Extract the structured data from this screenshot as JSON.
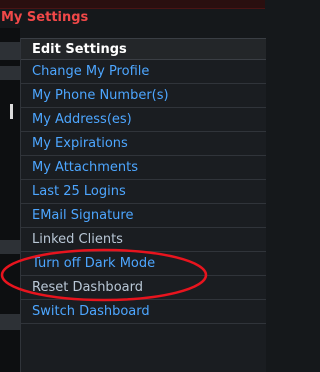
{
  "page": {
    "title": "My Settings"
  },
  "menu": {
    "header": "Edit Settings",
    "items": [
      {
        "label": "Change My Profile"
      },
      {
        "label": "My Phone Number(s)"
      },
      {
        "label": "My Address(es)"
      },
      {
        "label": "My Expirations"
      },
      {
        "label": "My Attachments"
      },
      {
        "label": "Last 25 Logins"
      },
      {
        "label": "EMail Signature"
      },
      {
        "label": "Linked Clients"
      },
      {
        "label": "Turn off Dark Mode"
      },
      {
        "label": "Reset Dashboard"
      },
      {
        "label": "Switch Dashboard"
      }
    ]
  },
  "colors": {
    "title": "#f04848",
    "link": "#4da6ff",
    "annotation": "#e8141e",
    "background": "#15181b"
  }
}
